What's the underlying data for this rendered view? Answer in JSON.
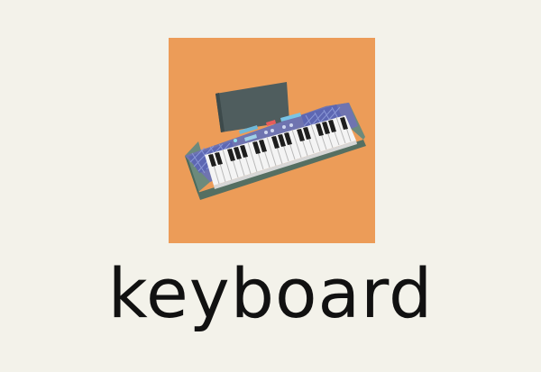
{
  "card": {
    "word": "keyboard",
    "background_color": "#f3f2ea",
    "tile_color": "#ec9c58"
  },
  "illustration": {
    "subject": "keyboard-icon"
  }
}
